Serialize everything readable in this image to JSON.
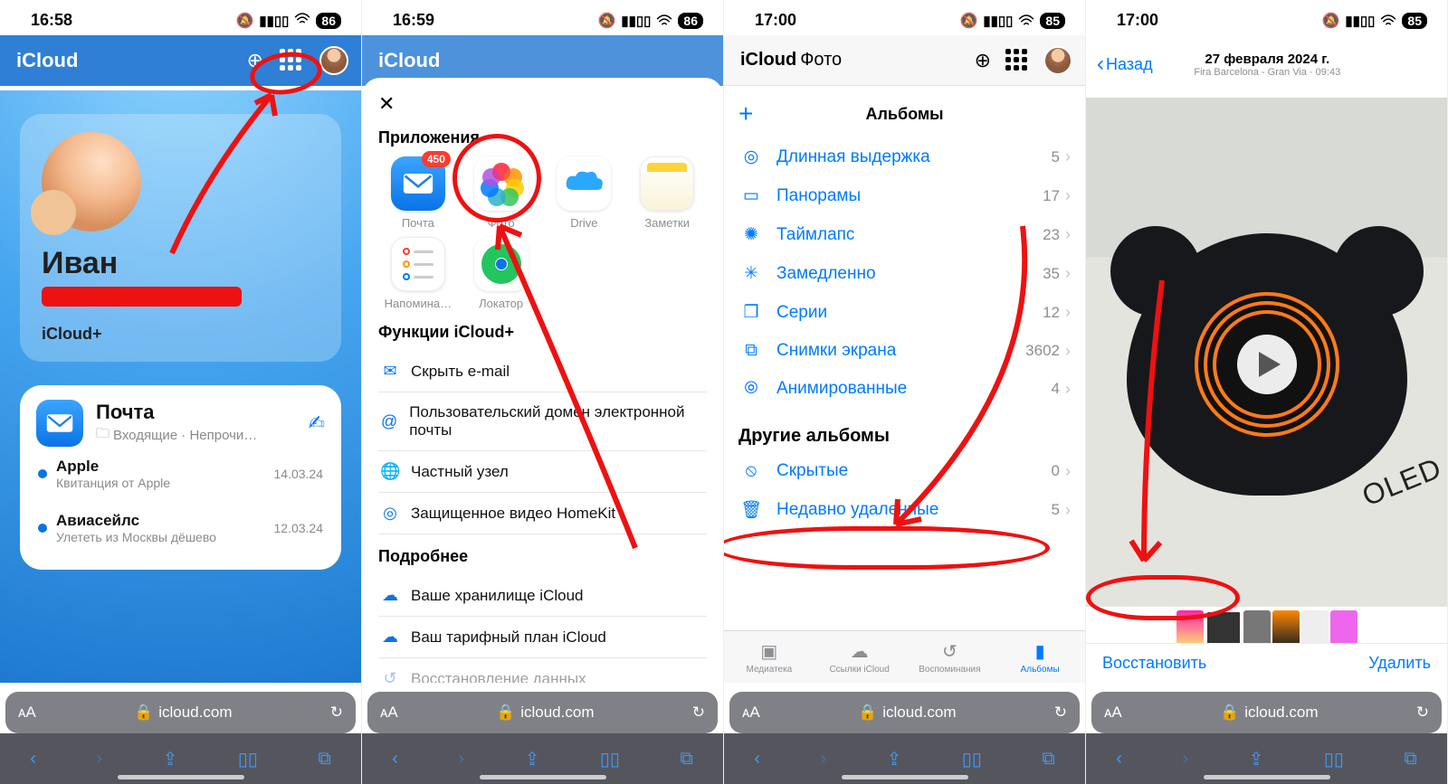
{
  "status": [
    {
      "time": "16:58",
      "batt": "86"
    },
    {
      "time": "16:59",
      "batt": "86"
    },
    {
      "time": "17:00",
      "batt": "85"
    },
    {
      "time": "17:00",
      "batt": "85"
    }
  ],
  "safari": {
    "domain": "icloud.com"
  },
  "s1": {
    "brand": "iCloud",
    "name": "Иван",
    "plan": "iCloud+",
    "mail": {
      "title": "Почта",
      "subtitle": "Входящие · Непрочи…",
      "msgs": [
        {
          "from": "Apple",
          "sub": "Квитанция от Apple",
          "date": "14.03.24"
        },
        {
          "from": "Авиасейлс",
          "sub": "Улететь из Москвы дёшево",
          "date": "12.03.24"
        }
      ]
    }
  },
  "s2": {
    "brand": "iCloud",
    "sec_apps": "Приложения",
    "apps": [
      {
        "label": "Почта",
        "badge": "450"
      },
      {
        "label": "Фото"
      },
      {
        "label": "Drive"
      },
      {
        "label": "Заметки"
      },
      {
        "label": "Напомина…"
      },
      {
        "label": "Локатор"
      }
    ],
    "sec_plus": "Функции iCloud+",
    "plus": [
      "Скрыть e-mail",
      "Пользовательский домен электронной почты",
      "Частный узел",
      "Защищенное видео HomeKit"
    ],
    "sec_more": "Подробнее",
    "more": [
      "Ваше хранилище iCloud",
      "Ваш тарифный план iCloud",
      "Восстановление данных"
    ]
  },
  "s3": {
    "brand_a": "iCloud",
    "brand_b": "Фото",
    "header": "Альбомы",
    "rows": [
      {
        "icon": "◎",
        "label": "Длинная выдержка",
        "count": "5"
      },
      {
        "icon": "▭",
        "label": "Панорамы",
        "count": "17"
      },
      {
        "icon": "✺",
        "label": "Таймлапс",
        "count": "23"
      },
      {
        "icon": "✳︎",
        "label": "Замедленно",
        "count": "35"
      },
      {
        "icon": "❐",
        "label": "Серии",
        "count": "12"
      },
      {
        "icon": "⧉",
        "label": "Снимки экрана",
        "count": "3602"
      },
      {
        "icon": "⦾",
        "label": "Анимированные",
        "count": "4"
      }
    ],
    "sec_other": "Другие альбомы",
    "other": [
      {
        "icon": "⦸",
        "label": "Скрытые",
        "count": "0"
      },
      {
        "icon": "🗑",
        "label": "Недавно удаленные",
        "count": "5"
      }
    ],
    "tabs": [
      "Медиатека",
      "Ссылки iCloud",
      "Воспоминания",
      "Альбомы"
    ]
  },
  "s4": {
    "back": "Назад",
    "date": "27 февраля 2024 г.",
    "loc": "Fira Barcelona - Gran Via · 09:43",
    "oled": "OLED Smₐ",
    "restore": "Восстановить",
    "delete": "Удалить"
  }
}
